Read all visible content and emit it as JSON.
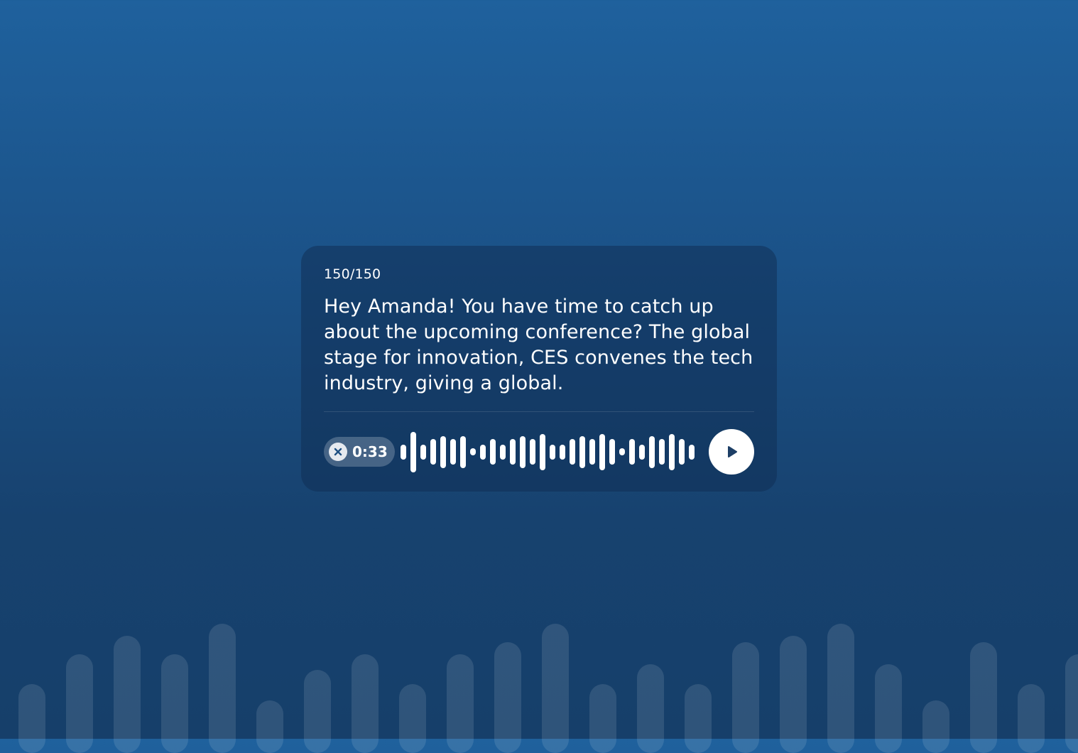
{
  "background": {
    "gradient_top": "#1f619d",
    "gradient_bottom": "#163f6a",
    "decorative_bars": [
      0.45,
      0.7,
      0.85,
      0.7,
      0.95,
      0.32,
      0.57,
      0.7,
      0.45,
      0.7,
      0.8,
      0.95,
      0.45,
      0.62,
      0.45,
      0.8,
      0.85,
      0.95,
      0.62,
      0.32,
      0.8,
      0.45,
      0.7
    ]
  },
  "message_card": {
    "char_counter": "150/150",
    "message_text": "Hey Amanda! You have time to catch up about the upcoming conference? The global stage for innovation, CES convenes the tech industry, giving a global."
  },
  "audio_player": {
    "cancel_icon": "close-icon",
    "duration": "0:33",
    "waveform_levels": [
      0.35,
      0.95,
      0.35,
      0.6,
      0.75,
      0.6,
      0.75,
      0.15,
      0.35,
      0.6,
      0.35,
      0.6,
      0.75,
      0.6,
      0.85,
      0.35,
      0.35,
      0.6,
      0.75,
      0.6,
      0.85,
      0.6,
      0.15,
      0.6,
      0.35,
      0.75,
      0.6,
      0.85,
      0.6,
      0.35
    ],
    "play_icon": "play-icon",
    "accent_color": "#ffffff"
  }
}
